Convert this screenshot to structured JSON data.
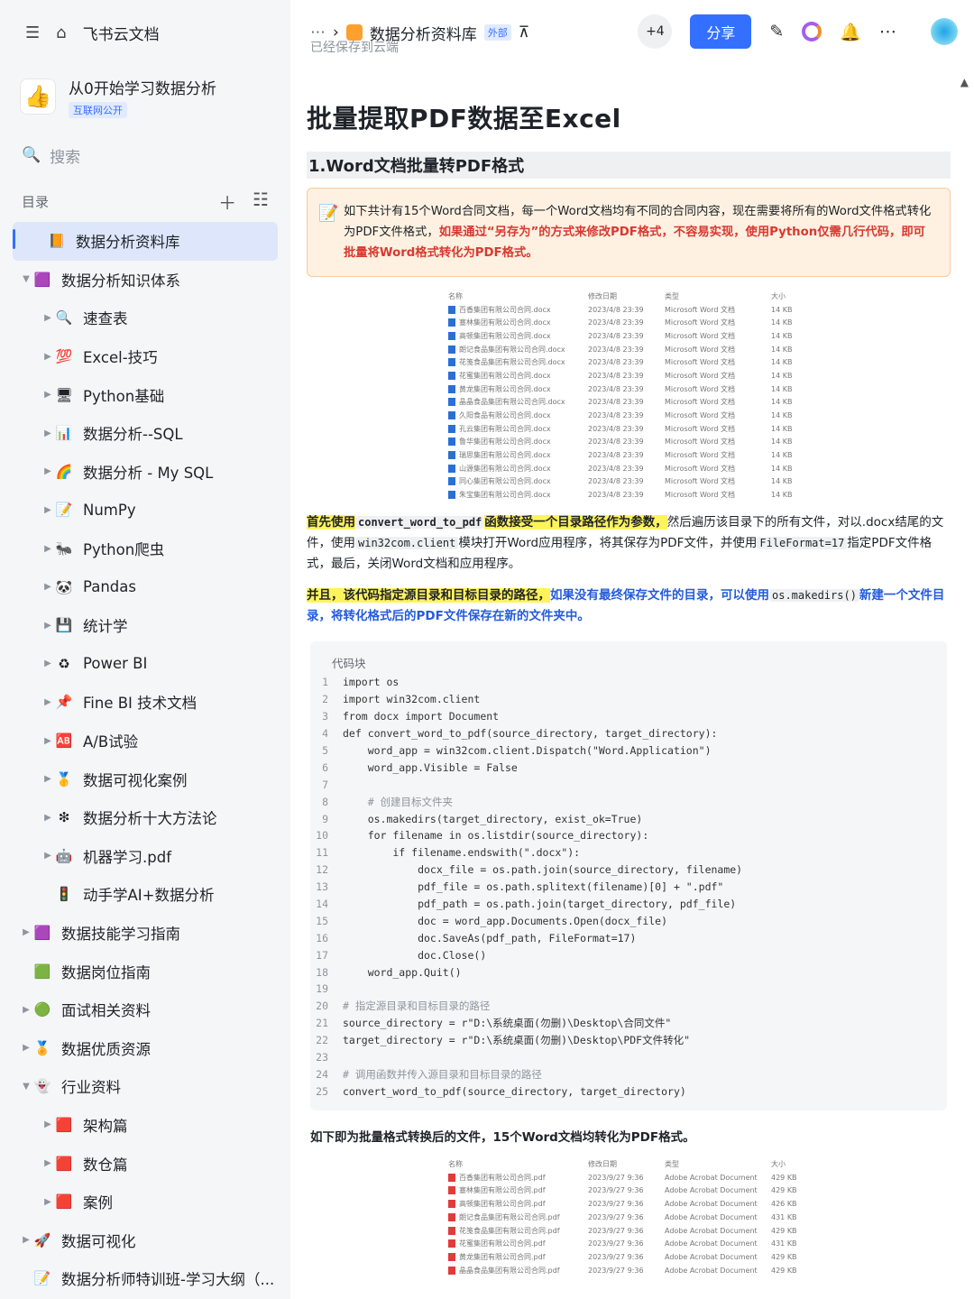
{
  "sidebar": {
    "app_name": "飞书云文档",
    "workspace": {
      "title": "从0开始学习数据分析",
      "badge": "互联网公开"
    },
    "search_placeholder": "搜索",
    "toc_label": "目录",
    "items": [
      {
        "label": "数据分析资料库",
        "level": 0,
        "arrow": "",
        "icon": "📙",
        "selected": true
      },
      {
        "label": "数据分析知识体系",
        "level": 0,
        "arrow": "▼",
        "icon": "🟪"
      },
      {
        "label": "速查表",
        "level": 1,
        "arrow": "▶",
        "icon": "🔍"
      },
      {
        "label": "Excel-技巧",
        "level": 1,
        "arrow": "▶",
        "icon": "💯"
      },
      {
        "label": "Python基础",
        "level": 1,
        "arrow": "▶",
        "icon": "🖥"
      },
      {
        "label": "数据分析--SQL",
        "level": 1,
        "arrow": "▶",
        "icon": "📊"
      },
      {
        "label": "数据分析 - My SQL",
        "level": 1,
        "arrow": "▶",
        "icon": "🌈"
      },
      {
        "label": "NumPy",
        "level": 1,
        "arrow": "▶",
        "icon": "📝"
      },
      {
        "label": "Python爬虫",
        "level": 1,
        "arrow": "▶",
        "icon": "🐜"
      },
      {
        "label": "Pandas",
        "level": 1,
        "arrow": "▶",
        "icon": "🐼"
      },
      {
        "label": "统计学",
        "level": 1,
        "arrow": "▶",
        "icon": "💾"
      },
      {
        "label": "Power BI",
        "level": 1,
        "arrow": "▶",
        "icon": "♻"
      },
      {
        "label": "Fine BI 技术文档",
        "level": 1,
        "arrow": "▶",
        "icon": "📌"
      },
      {
        "label": "A/B试验",
        "level": 1,
        "arrow": "▶",
        "icon": "🆎"
      },
      {
        "label": "数据可视化案例",
        "level": 1,
        "arrow": "▶",
        "icon": "🥇"
      },
      {
        "label": "数据分析十大方法论",
        "level": 1,
        "arrow": "▶",
        "icon": "❇"
      },
      {
        "label": "机器学习.pdf",
        "level": 1,
        "arrow": "▶",
        "icon": "🤖"
      },
      {
        "label": "动手学AI+数据分析",
        "level": 1,
        "arrow": "",
        "icon": "🚦"
      },
      {
        "label": "数据技能学习指南",
        "level": 0,
        "arrow": "▶",
        "icon": "🟪"
      },
      {
        "label": "数据岗位指南",
        "level": 0,
        "arrow": "",
        "icon": "🟩"
      },
      {
        "label": "面试相关资料",
        "level": 0,
        "arrow": "▶",
        "icon": "🟢"
      },
      {
        "label": "数据优质资源",
        "level": 0,
        "arrow": "▶",
        "icon": "🏅"
      },
      {
        "label": "行业资料",
        "level": 0,
        "arrow": "▼",
        "icon": "👻"
      },
      {
        "label": "架构篇",
        "level": 1,
        "arrow": "▶",
        "icon": "🟥"
      },
      {
        "label": "数仓篇",
        "level": 1,
        "arrow": "▶",
        "icon": "🟥"
      },
      {
        "label": "案例",
        "level": 1,
        "arrow": "▶",
        "icon": "🟥"
      },
      {
        "label": "数据可视化",
        "level": 0,
        "arrow": "▶",
        "icon": "🚀"
      },
      {
        "label": "数据分析师特训班-学习大纲（...",
        "level": 0,
        "arrow": "",
        "icon": "📝"
      }
    ]
  },
  "topbar": {
    "breadcrumb": "数据分析资料库",
    "tag": "外部",
    "saved": "已经保存到云端",
    "collaborators": "+4",
    "share_label": "分享"
  },
  "doc": {
    "title": "批量提取PDF数据至Excel",
    "h2": "1.Word文档批量转PDF格式",
    "callout_a": "如下共计有15个Word合同文档，每一个Word文档均有不同的合同内容，现在需要将所有的Word文件格式转化为PDF文件格式，",
    "callout_b": "如果通过“另存为”的方式来修改PDF格式，不容易实现，使用Python仅需几行代码，即可批量将Word格式转化为PDF格式。",
    "word_list": {
      "headers": [
        "名称",
        "修改日期",
        "类型",
        "大小"
      ],
      "names": [
        "百香集团有限公司合同.docx",
        "塞林集团有限公司合同.docx",
        "高顿集团有限公司合同.docx",
        "朗记食品集团有限公司合同.docx",
        "花笺食品集团有限公司合同.docx",
        "花蜜集团有限公司合同.docx",
        "黄龙集团有限公司合同.docx",
        "晶晶食品集团有限公司合同.docx",
        "久阳食品有限公司合同.docx",
        "孔云集团有限公司合同.docx",
        "鲁华集团有限公司合同.docx",
        "瑞思集团有限公司合同.docx",
        "山源集团有限公司合同.docx",
        "同心集团有限公司合同.docx",
        "朱宝集团有限公司合同.docx"
      ],
      "date": "2023/4/8 23:39",
      "type": "Microsoft Word 文档",
      "size": "14 KB"
    },
    "p1_hl1": "首先使用",
    "p1_code1": "convert_word_to_pdf",
    "p1_hl2": "函数接受一个目录路径作为参数，",
    "p1_a": "然后遍历该目录下的所有文件，对以.docx结尾的文件，使用",
    "p1_code2": "win32com.client",
    "p1_b": "模块打开Word应用程序，将其保存为PDF文件，并使用",
    "p1_code3": "FileFormat=17",
    "p1_c": "指定PDF文件格式，最后，关闭Word文档和应用程序。",
    "p2_hl": "并且，该代码指定源目录和目标目录的路径，",
    "p2_a": "如果没有最终保存文件的目录，可以使用",
    "p2_code": "os.makedirs()",
    "p2_b": "新建一个文件目录，将转化格式后的PDF文件保存在新的文件夹中。",
    "code_label": "代码块",
    "code": [
      "import os",
      "import win32com.client",
      "from docx import Document",
      "def convert_word_to_pdf(source_directory, target_directory):",
      "    word_app = win32com.client.Dispatch(\"Word.Application\")",
      "    word_app.Visible = False",
      "",
      "    # 创建目标文件夹",
      "    os.makedirs(target_directory, exist_ok=True)",
      "    for filename in os.listdir(source_directory):",
      "        if filename.endswith(\".docx\"):",
      "            docx_file = os.path.join(source_directory, filename)",
      "            pdf_file = os.path.splitext(filename)[0] + \".pdf\"",
      "            pdf_path = os.path.join(target_directory, pdf_file)",
      "            doc = word_app.Documents.Open(docx_file)",
      "            doc.SaveAs(pdf_path, FileFormat=17)",
      "            doc.Close()",
      "    word_app.Quit()",
      "",
      "# 指定源目录和目标目录的路径",
      "source_directory = r\"D:\\系统桌面(勿删)\\Desktop\\合同文件\"",
      "target_directory = r\"D:\\系统桌面(勿删)\\Desktop\\PDF文件转化\"",
      "",
      "# 调用函数并传入源目录和目标目录的路径",
      "convert_word_to_pdf(source_directory, target_directory)"
    ],
    "caption": "如下即为批量格式转换后的文件，15个Word文档均转化为PDF格式。",
    "pdf_list": {
      "headers": [
        "名称",
        "修改日期",
        "类型",
        "大小"
      ],
      "names": [
        "百香集团有限公司合同.pdf",
        "塞林集团有限公司合同.pdf",
        "高顿集团有限公司合同.pdf",
        "朗记食品集团有限公司合同.pdf",
        "花笺食品集团有限公司合同.pdf",
        "花蜜集团有限公司合同.pdf",
        "黄龙集团有限公司合同.pdf",
        "晶晶食品集团有限公司合同.pdf"
      ],
      "date": "2023/9/27 9:36",
      "type": "Adobe Acrobat Document",
      "sizes": [
        "429 KB",
        "429 KB",
        "426 KB",
        "431 KB",
        "429 KB",
        "431 KB",
        "429 KB",
        "429 KB"
      ]
    }
  }
}
